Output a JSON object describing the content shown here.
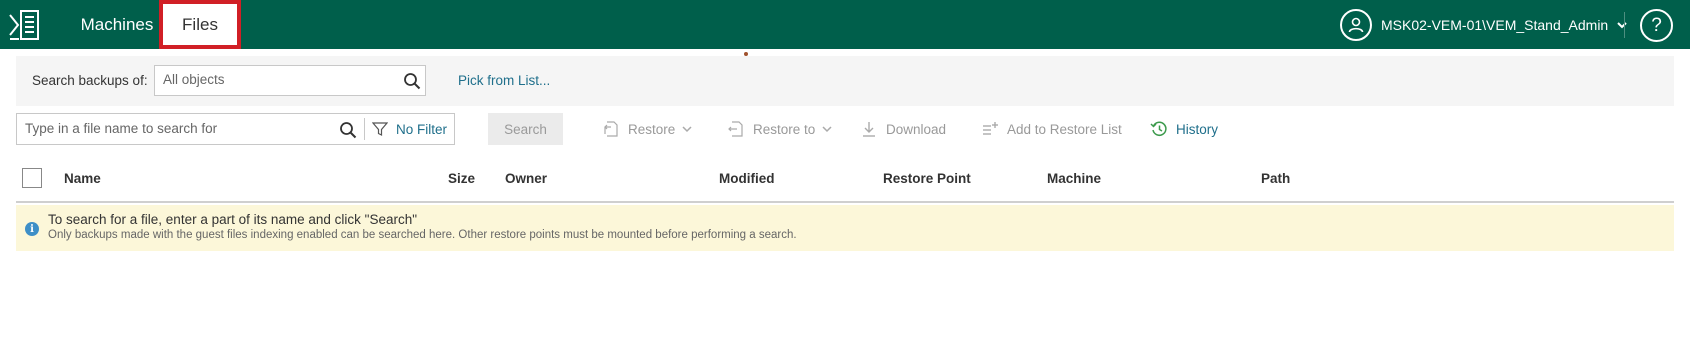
{
  "nav": {
    "tabs": [
      {
        "label": "Machines",
        "active": false
      },
      {
        "label": "Files",
        "active": true
      }
    ],
    "user": "MSK02-VEM-01\\VEM_Stand_Admin",
    "help_label": "?"
  },
  "search_backups": {
    "label": "Search backups of:",
    "placeholder": "All objects",
    "pick_link": "Pick from List..."
  },
  "toolbar": {
    "file_placeholder": "Type in a file name to search for",
    "filter_label": "No Filter",
    "search_label": "Search",
    "actions": {
      "restore": "Restore",
      "restore_to": "Restore to",
      "download": "Download",
      "add_to_restore_list": "Add to Restore List",
      "history": "History"
    }
  },
  "table": {
    "columns": [
      "Name",
      "Size",
      "Owner",
      "Modified",
      "Restore Point",
      "Machine",
      "Path"
    ]
  },
  "info": {
    "title": "To search for a file, enter a part of its name and click \"Search\"",
    "subtitle": "Only backups made with the guest files indexing enabled can be searched here. Other restore points must be mounted before performing a search."
  },
  "colors": {
    "header_bg": "#005f4b",
    "active_tab_border": "#d11f26",
    "link": "#1f6f8b",
    "banner_bg": "#fcf7d9",
    "info_icon": "#3e8fc7"
  }
}
